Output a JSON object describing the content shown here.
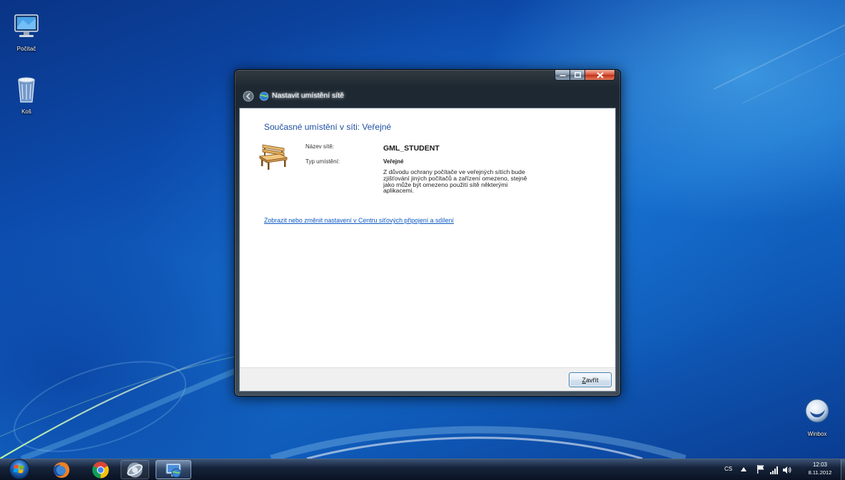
{
  "desktop": {
    "icons": [
      {
        "label": "Počítač",
        "icon": "computer-icon"
      },
      {
        "label": "Koš",
        "icon": "recycle-bin-icon"
      },
      {
        "label": "Winbox",
        "icon": "winbox-icon"
      }
    ]
  },
  "dialog": {
    "title": "Nastavit umístění sítě",
    "title_icon": "network-icon",
    "back_icon": "back-arrow-icon",
    "caption_buttons": [
      "minimize-icon",
      "maximize-icon",
      "close-icon"
    ],
    "heading": "Současné umístění v síti: Veřejné",
    "location_icon": "park-bench-icon",
    "fields": [
      {
        "label": "Název sítě:",
        "value": "GML_STUDENT"
      },
      {
        "label": "Typ umístění:",
        "value": "Veřejné"
      }
    ],
    "description_lines": [
      "Z důvodu ochrany počítače ve veřejných sítích bude",
      "zjišťování jiných počítačů a zařízení omezeno, stejně",
      "jako může být omezeno použití sítě některými",
      "aplikacemi."
    ],
    "link": "Zobrazit nebo změnit nastavení v Centru síťových připojení a sdílení",
    "close_button": "Zavřít"
  },
  "taskbar": {
    "start_icon": "windows-start-icon",
    "items": [
      {
        "icon": "firefox-icon",
        "highlighted": false
      },
      {
        "icon": "chrome-icon",
        "highlighted": false
      },
      {
        "icon": "app-icon",
        "highlighted": false
      },
      {
        "icon": "network-location-icon",
        "highlighted": true
      }
    ],
    "tray": {
      "language": "CS",
      "icons": [
        "show-hidden-icons-icon",
        "action-center-flag-icon",
        "network-signal-icon",
        "volume-icon"
      ],
      "time": "12:03",
      "date": "8.11.2012"
    }
  },
  "colors": {
    "heading": "#1d4fa0",
    "link": "#0b58c4",
    "close_caption_button": "#c8412b",
    "taskbar": "#0a1323",
    "desktop": "#0e51b2"
  }
}
